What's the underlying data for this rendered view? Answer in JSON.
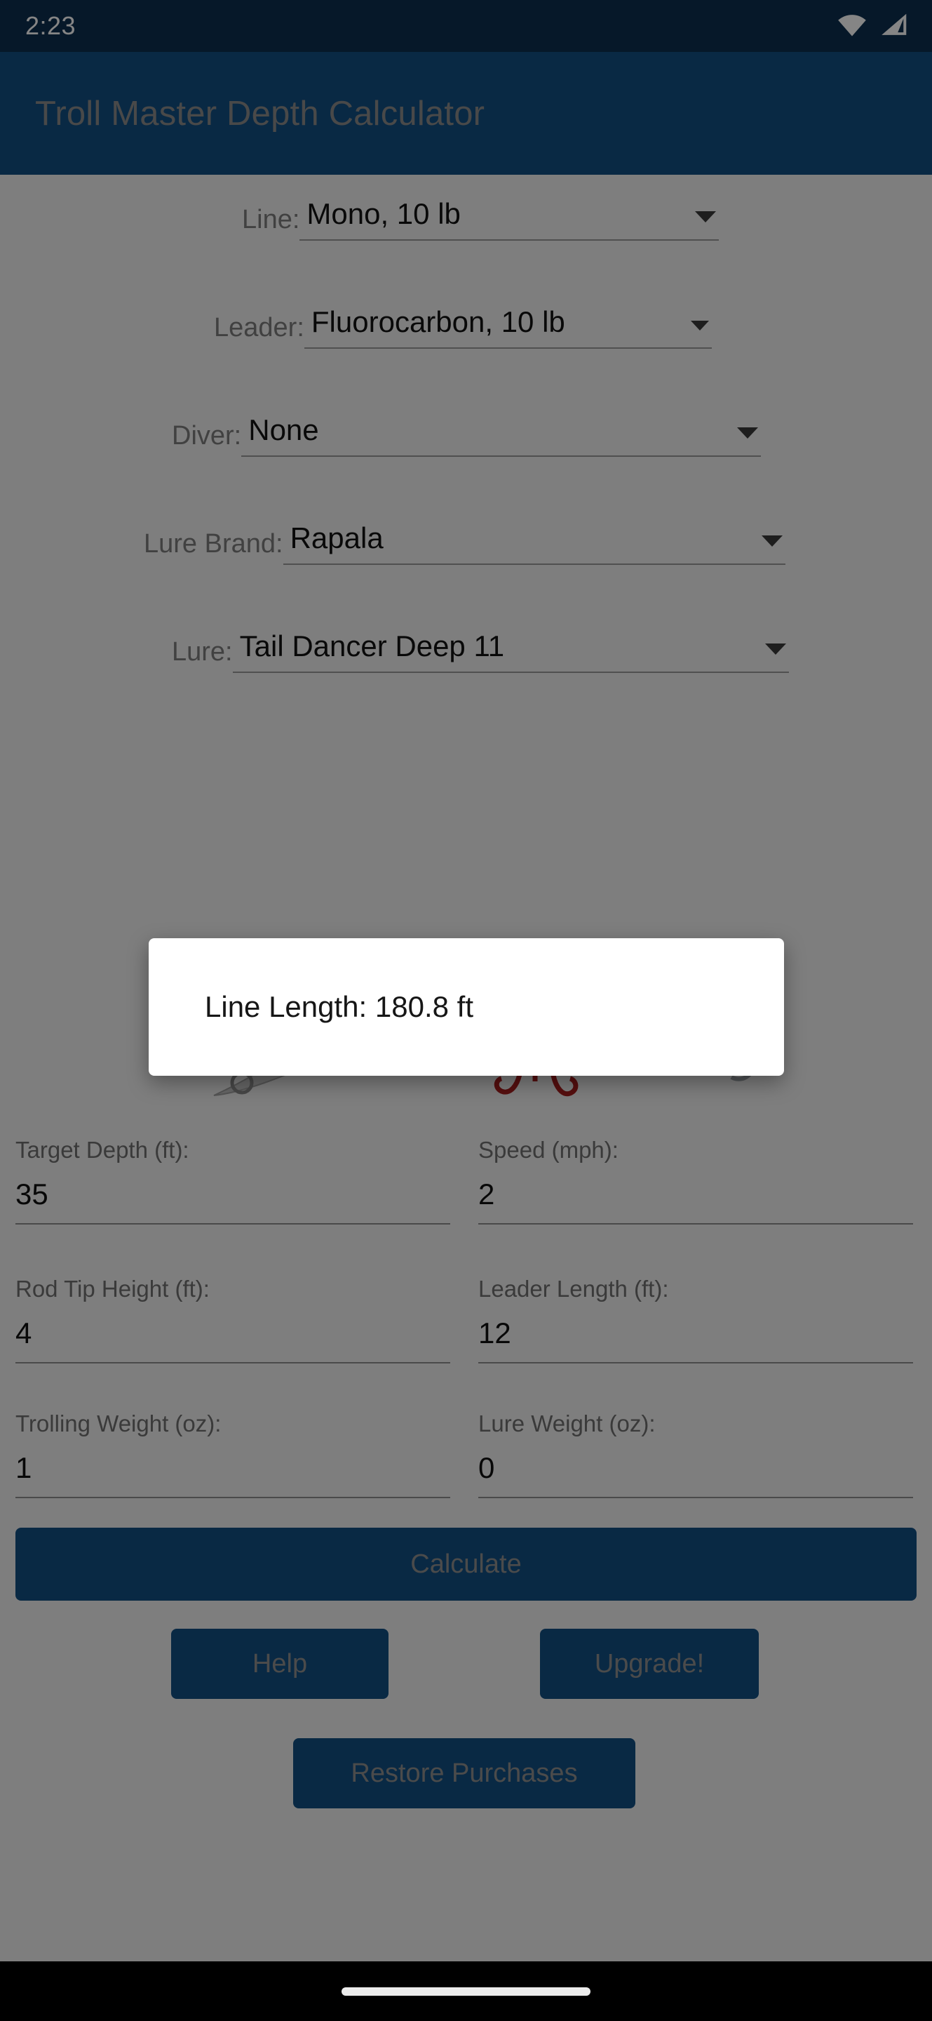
{
  "status_bar": {
    "clock": "2:23",
    "icons": [
      "wifi-icon",
      "cell-signal-icon"
    ],
    "background_color": "#0d2f4f"
  },
  "app_bar": {
    "title": "Troll Master Depth Calculator",
    "background_color": "#125083",
    "title_color": "#8d8d8d"
  },
  "selects": [
    {
      "label": "Line:",
      "value": "Mono, 10 lb"
    },
    {
      "label": "Leader:",
      "value": "Fluorocarbon, 10 lb"
    },
    {
      "label": "Diver:",
      "value": "None"
    },
    {
      "label": "Lure Brand:",
      "value": "Rapala"
    },
    {
      "label": "Lure:",
      "value": "Tail Dancer Deep 11"
    }
  ],
  "lure_image": {
    "name": "fishing-lure-firetiger",
    "colors": {
      "back": "#1fa236",
      "body": "#e8d534",
      "belly": "#ef7a1c",
      "stripes": "#121212",
      "lip": "#c9c9c9",
      "hook": "#a8abb0",
      "front_hook": "#a81d1d"
    }
  },
  "fields": [
    {
      "label": "Target Depth (ft):",
      "value": "35"
    },
    {
      "label": "Speed (mph):",
      "value": "2"
    },
    {
      "label": "Rod Tip Height (ft):",
      "value": "4"
    },
    {
      "label": "Leader Length (ft):",
      "value": "12"
    },
    {
      "label": "Trolling Weight (oz):",
      "value": "1"
    },
    {
      "label": "Lure Weight (oz):",
      "value": "0"
    }
  ],
  "buttons": {
    "calculate": "Calculate",
    "help": "Help",
    "upgrade": "Upgrade!",
    "restore": "Restore Purchases",
    "color": "#125083",
    "text_color": "#909090"
  },
  "dialog": {
    "message": "Line Length: 180.8 ft",
    "background_color": "#ffffff"
  },
  "nav_bar": {
    "home_indicator": "home-indicator",
    "background_color": "#000000"
  }
}
